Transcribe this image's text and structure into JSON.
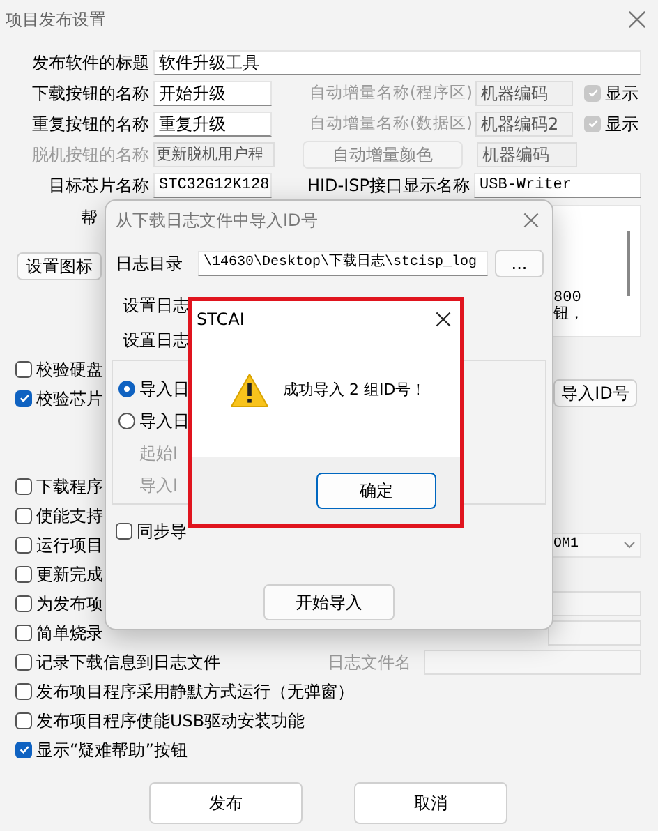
{
  "window": {
    "title": "项目发布设置"
  },
  "title_field": {
    "label": "发布软件的标题",
    "value": "软件升级工具"
  },
  "download_button_name": {
    "label": "下载按钮的名称",
    "value": "开始升级"
  },
  "repeat_button_name": {
    "label": "重复按钮的名称",
    "value": "重复升级"
  },
  "offline_button_name": {
    "label": "脱机按钮的名称",
    "value": "更新脱机用户程",
    "disabled": true
  },
  "auto_increment": [
    {
      "label": "自动增量名称(程序区)",
      "value": "机器编码",
      "show_label": "显示",
      "show_checked": true,
      "disabled": true
    },
    {
      "label": "自动增量名称(数据区)",
      "value": "机器编码2",
      "show_label": "显示",
      "show_checked": true,
      "disabled": true
    }
  ],
  "auto_increment_color": {
    "label": "自动增量颜色",
    "value": "机器编码",
    "disabled": true
  },
  "target_chip": {
    "label": "目标芯片名称",
    "value": "STC32G12K128"
  },
  "hid_name": {
    "label": "HID-ISP接口显示名称",
    "value": "USB-Writer"
  },
  "help": {
    "label": "帮",
    "lines": [
      "800",
      "钮，"
    ]
  },
  "set_icon_button": "设置图标",
  "verify_options": [
    {
      "label": "校验硬盘",
      "checked": false
    },
    {
      "label": "校验芯片",
      "checked": true
    }
  ],
  "import_id_button": "导入ID号",
  "options": [
    {
      "label": "下载程序",
      "checked": false
    },
    {
      "label": "使能支持",
      "checked": false
    },
    {
      "label": "运行项目",
      "checked": false
    },
    {
      "label": "更新完成",
      "checked": false
    },
    {
      "label": "为发布项",
      "checked": false
    },
    {
      "label": "简单烧录",
      "checked": false
    },
    {
      "label": "记录下载信息到日志文件",
      "checked": false
    },
    {
      "label": "发布项目程序采用静默方式运行（无弹窗）",
      "checked": false
    },
    {
      "label": "发布项目程序使能USB驱动安装功能",
      "checked": false
    },
    {
      "label": "显示“疑难帮助”按钮",
      "checked": true
    }
  ],
  "port_select": {
    "value": "OM1"
  },
  "log_file": {
    "label": "日志文件名",
    "disabled": true
  },
  "buttons": [
    "发布",
    "取消"
  ],
  "import_dialog": {
    "title": "从下载日志文件中导入ID号",
    "log_dir": {
      "label": "日志目录",
      "value": "\\14630\\Desktop\\下载日志\\stcisp_log",
      "browse": "..."
    },
    "start_date": {
      "label": "设置日志"
    },
    "row_3_label": "设置日志",
    "modes": [
      {
        "label": "导入日",
        "selected": true
      },
      {
        "label": "导入日",
        "selected": false
      }
    ],
    "sub_fields": [
      {
        "label": "起始I",
        "disabled": true
      },
      {
        "label": "导入I",
        "disabled": true
      }
    ],
    "sync": {
      "label": "同步导",
      "checked": false
    },
    "start_button": "开始导入"
  },
  "message_box": {
    "title": "STCAI",
    "message": "成功导入 2 组ID号！",
    "ok": "确定"
  }
}
